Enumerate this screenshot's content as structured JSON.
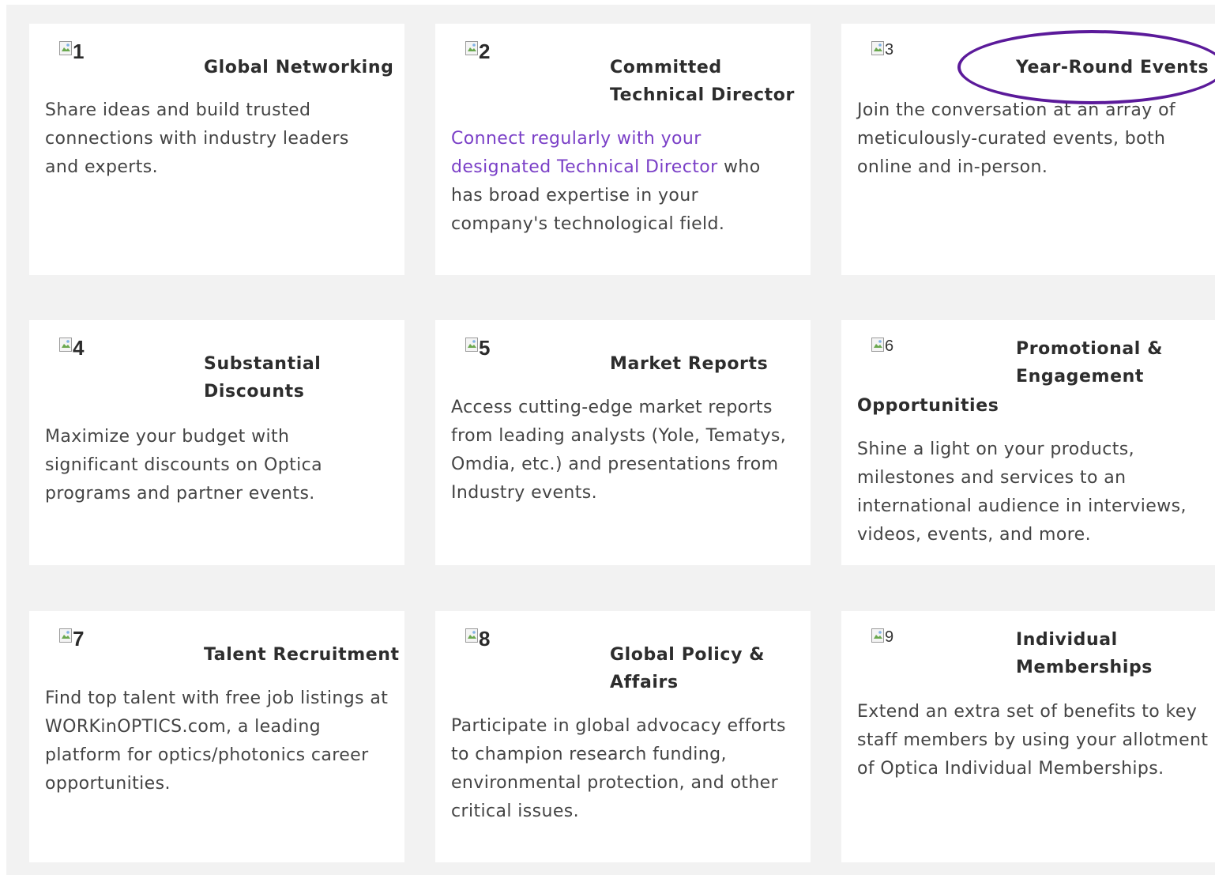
{
  "cards": [
    {
      "icon_alt": "1",
      "title": "Global Networking",
      "body": "Share ideas and build trusted connections with industry leaders and experts."
    },
    {
      "icon_alt": "2",
      "title": "Committed Technical Director",
      "link_text": "Connect regularly with your designated Technical Director",
      "body_after_link": " who has broad expertise in your company's technological field."
    },
    {
      "icon_alt": "3",
      "title": "Year-Round Events",
      "body": "Join the conversation at an array of meticulously-curated events, both online and in-person."
    },
    {
      "icon_alt": "4",
      "title": "Substantial Discounts",
      "body": "Maximize your budget with significant discounts on Optica programs and partner events."
    },
    {
      "icon_alt": "5",
      "title": "Market Reports",
      "body": "Access cutting-edge market reports from leading analysts (Yole, Tematys, Omdia, etc.) and presentations from Industry events."
    },
    {
      "icon_alt": "6",
      "title_line1": "Promotional &",
      "title_line2": "Engagement",
      "title_line3": "Opportunities",
      "body": "Shine a light on your products, milestones and services to an international audience in interviews, videos, events, and more."
    },
    {
      "icon_alt": "7",
      "title": "Talent Recruitment",
      "body": "Find top talent with free job listings at WORKinOPTICS.com, a leading platform for optics/photonics career opportunities."
    },
    {
      "icon_alt": "8",
      "title": "Global Policy & Affairs",
      "body": "Participate in global advocacy efforts to champion research funding, environmental protection, and other critical issues."
    },
    {
      "icon_alt": "9",
      "title": "Individual Memberships",
      "body": "Extend an extra set of benefits to key staff members by using your allotment of Optica Individual Memberships."
    }
  ],
  "colors": {
    "page_background": "#f2f2f2",
    "card_background": "#ffffff",
    "link": "#7a3fc7",
    "highlight": "#5b1a9a"
  }
}
